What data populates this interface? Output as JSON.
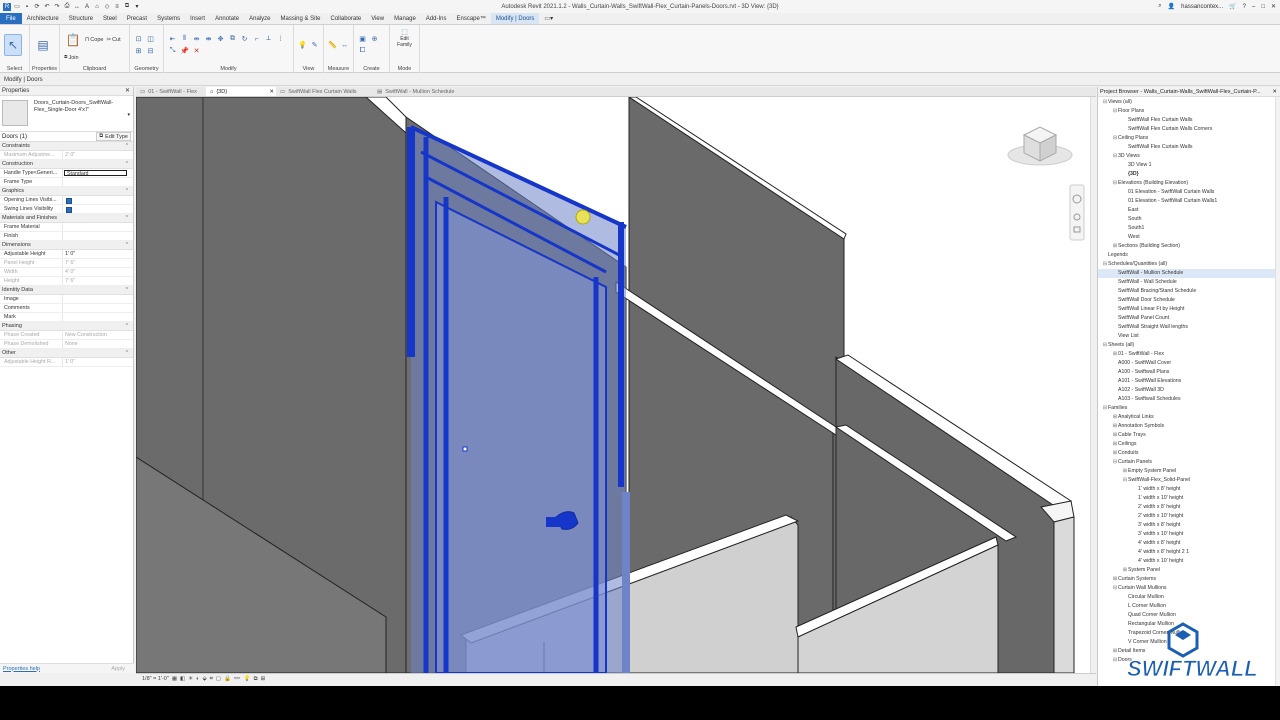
{
  "window": {
    "title": "Autodesk Revit 2021.1.2 - Walls_Curtain-Walls_SwiftWall-Flex_Curtain-Panels-Doors.rvt - 3D View: {3D}",
    "user": "hassancontex..."
  },
  "ribbon": {
    "tabs": [
      "File",
      "Architecture",
      "Structure",
      "Steel",
      "Precast",
      "Systems",
      "Insert",
      "Annotate",
      "Analyze",
      "Massing & Site",
      "Collaborate",
      "View",
      "Manage",
      "Add-Ins",
      "Enscape™",
      "Modify | Doors"
    ],
    "panels": {
      "select": "Select",
      "properties": "Properties",
      "clipboard": "Clipboard",
      "geometry": "Geometry",
      "modify": "Modify",
      "view": "View",
      "measure": "Measure",
      "create": "Create",
      "mode": "Mode"
    },
    "tool_labels": {
      "modify": "Modify",
      "paste": "Paste",
      "cope": "Cope",
      "cut": "Cut",
      "join": "Join",
      "edit_family": "Edit Family"
    }
  },
  "modeline": "Modify | Doors",
  "properties": {
    "header": "Properties",
    "type_name": "Doors_Curtain-Doors_SwiftWall-Flex_Single-Door 4'x7'",
    "instance_label": "Doors (1)",
    "edit_type": "Edit Type",
    "sections": [
      {
        "name": "Constraints",
        "rows": [
          {
            "k": "Maximum Adjustme...",
            "v": "2' 0\"",
            "grey": true
          }
        ]
      },
      {
        "name": "Construction",
        "rows": [
          {
            "k": "Handle Type<Generi...",
            "v": "Standard",
            "boxed": true
          },
          {
            "k": "Frame Type",
            "v": ""
          }
        ]
      },
      {
        "name": "Graphics",
        "rows": [
          {
            "k": "Opening Lines Visibi...",
            "v": "",
            "check": true
          },
          {
            "k": "Swing Lines Visibility",
            "v": "",
            "check": true
          }
        ]
      },
      {
        "name": "Materials and Finishes",
        "rows": [
          {
            "k": "Frame Material",
            "v": ""
          },
          {
            "k": "Finish",
            "v": ""
          }
        ]
      },
      {
        "name": "Dimensions",
        "rows": [
          {
            "k": "Adjustable Height",
            "v": "1' 0\""
          },
          {
            "k": "Panel Height",
            "v": "7' 6\"",
            "grey": true
          },
          {
            "k": "Width",
            "v": "4' 0\"",
            "grey": true
          },
          {
            "k": "Height",
            "v": "7' 6\"",
            "grey": true
          }
        ]
      },
      {
        "name": "Identity Data",
        "rows": [
          {
            "k": "Image",
            "v": ""
          },
          {
            "k": "Comments",
            "v": ""
          },
          {
            "k": "Mark",
            "v": ""
          }
        ]
      },
      {
        "name": "Phasing",
        "rows": [
          {
            "k": "Phase Created",
            "v": "New Construction",
            "grey": true
          },
          {
            "k": "Phase Demolished",
            "v": "None",
            "grey": true
          }
        ]
      },
      {
        "name": "Other",
        "rows": [
          {
            "k": "Adjustable Height R...",
            "v": "1' 0\"",
            "grey": true
          }
        ]
      }
    ],
    "help_link": "Properties help",
    "apply": "Apply"
  },
  "view_tabs": [
    {
      "label": "01 - SwiftWall - Flex",
      "active": false
    },
    {
      "label": "{3D}",
      "active": true
    },
    {
      "label": "SwiftWall Flex Curtain Walls",
      "active": false
    },
    {
      "label": "SwiftWall - Mullion Schedule",
      "active": false
    }
  ],
  "view_control": {
    "scale": "1/8\" = 1'-0\""
  },
  "browser": {
    "header": "Project Browser - Walls_Curtain-Walls_SwiftWall-Flex_Curtain-P...",
    "items": [
      {
        "label": "Views (all)",
        "level": 0,
        "toggle": "−"
      },
      {
        "label": "Floor Plans",
        "level": 1,
        "toggle": "−"
      },
      {
        "label": "SwiftWall Flex Curtain Walls",
        "level": 2
      },
      {
        "label": "SwiftWall Flex Curtain Walls Corners",
        "level": 2
      },
      {
        "label": "Ceiling Plans",
        "level": 1,
        "toggle": "−"
      },
      {
        "label": "SwiftWall Flex Curtain Walls",
        "level": 2
      },
      {
        "label": "3D Views",
        "level": 1,
        "toggle": "−"
      },
      {
        "label": "3D View 1",
        "level": 2
      },
      {
        "label": "{3D}",
        "level": 2,
        "bold": true
      },
      {
        "label": "Elevations (Building Elevation)",
        "level": 1,
        "toggle": "−"
      },
      {
        "label": "01 Elevation - SwiftWall Curtain Walls",
        "level": 2
      },
      {
        "label": "01 Elevation - SwiftWall Curtain Walls1",
        "level": 2
      },
      {
        "label": "East",
        "level": 2
      },
      {
        "label": "South",
        "level": 2
      },
      {
        "label": "South1",
        "level": 2
      },
      {
        "label": "West",
        "level": 2
      },
      {
        "label": "Sections (Building Section)",
        "level": 1,
        "toggle": "+"
      },
      {
        "label": "Legends",
        "level": 0,
        "toggle": ""
      },
      {
        "label": "Schedules/Quantities (all)",
        "level": 0,
        "toggle": "−"
      },
      {
        "label": "SwiftWall - Mullion Schedule",
        "level": 1,
        "sel": true
      },
      {
        "label": "SwiftWall - Wall Schedule",
        "level": 1
      },
      {
        "label": "SwiftWall Bracing/Stand Schedule",
        "level": 1
      },
      {
        "label": "SwiftWall Door Schedule",
        "level": 1
      },
      {
        "label": "SwiftWall Linear Ft by Height",
        "level": 1
      },
      {
        "label": "SwiftWall Panel Count",
        "level": 1
      },
      {
        "label": "SwiftWall Straight Wall lengths",
        "level": 1
      },
      {
        "label": "View List",
        "level": 1
      },
      {
        "label": "Sheets (all)",
        "level": 0,
        "toggle": "−"
      },
      {
        "label": "01 - SwiftWall - Flex",
        "level": 1,
        "toggle": "+"
      },
      {
        "label": "A000 - SwiftWall Cover",
        "level": 1
      },
      {
        "label": "A100 - Swiftwall Plans",
        "level": 1
      },
      {
        "label": "A101 - SwiftWall Elevations",
        "level": 1
      },
      {
        "label": "A102 - SwiftWall 3D",
        "level": 1
      },
      {
        "label": "A103 - Swiftwall Schedules",
        "level": 1
      },
      {
        "label": "Families",
        "level": 0,
        "toggle": "−"
      },
      {
        "label": "Analytical Links",
        "level": 1,
        "toggle": "+"
      },
      {
        "label": "Annotation Symbols",
        "level": 1,
        "toggle": "+"
      },
      {
        "label": "Cable Trays",
        "level": 1,
        "toggle": "+"
      },
      {
        "label": "Ceilings",
        "level": 1,
        "toggle": "+"
      },
      {
        "label": "Conduits",
        "level": 1,
        "toggle": "+"
      },
      {
        "label": "Curtain Panels",
        "level": 1,
        "toggle": "−"
      },
      {
        "label": "Empty System Panel",
        "level": 2,
        "toggle": "+"
      },
      {
        "label": "SwiftWall-Flex_Solid-Panel",
        "level": 2,
        "toggle": "−"
      },
      {
        "label": "1' width x 8' height",
        "level": 3
      },
      {
        "label": "1' width x 10' height",
        "level": 3
      },
      {
        "label": "2' width x 8' height",
        "level": 3
      },
      {
        "label": "2' width x 10' height",
        "level": 3
      },
      {
        "label": "3' width x 8' height",
        "level": 3
      },
      {
        "label": "3' width x 10' height",
        "level": 3
      },
      {
        "label": "4' width x 8' height",
        "level": 3
      },
      {
        "label": "4' width x 8' height 2 1",
        "level": 3
      },
      {
        "label": "4' width x 10' height",
        "level": 3
      },
      {
        "label": "System Panel",
        "level": 2,
        "toggle": "+"
      },
      {
        "label": "Curtain Systems",
        "level": 1,
        "toggle": "+"
      },
      {
        "label": "Curtain Wall Mullions",
        "level": 1,
        "toggle": "−"
      },
      {
        "label": "Circular Mullion",
        "level": 2
      },
      {
        "label": "L Corner Mullion",
        "level": 2
      },
      {
        "label": "Quad Corner Mullion",
        "level": 2
      },
      {
        "label": "Rectangular Mullion",
        "level": 2
      },
      {
        "label": "Trapezoid Corner Mullion",
        "level": 2
      },
      {
        "label": "V Corner Mullion",
        "level": 2
      },
      {
        "label": "Detail Items",
        "level": 1,
        "toggle": "+"
      },
      {
        "label": "Doors",
        "level": 1,
        "toggle": "−"
      }
    ]
  },
  "logo": {
    "text": "SWIFTWALL",
    "color": "#1a5fb4"
  }
}
